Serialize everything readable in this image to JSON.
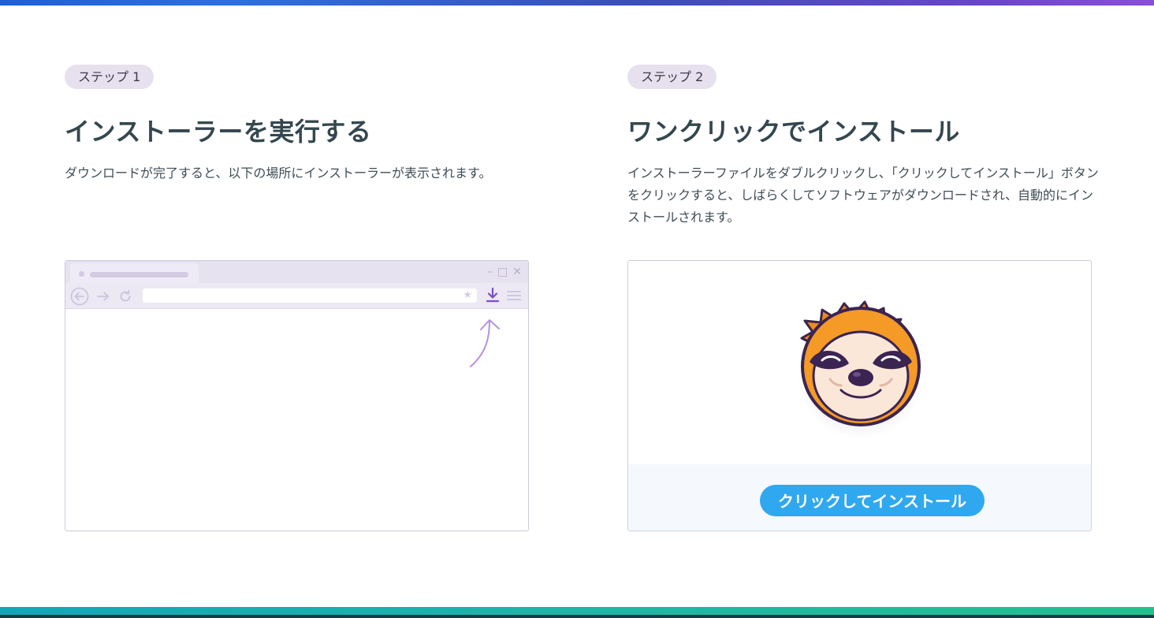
{
  "step1": {
    "pill": "ステップ 1",
    "title": "インストーラーを実行する",
    "description": "ダウンロードが完了すると、以下の場所にインストーラーが表示されます。"
  },
  "step2": {
    "pill": "ステップ 2",
    "title": "ワンクリックでインストール",
    "description": "インストーラーファイルをダブルクリックし、「クリックしてインストール」ボタンをクリックすると、しばらくしてソフトウェアがダウンロードされ、自動的にインストールされます。",
    "button_label": "クリックしてインストール"
  },
  "icons": {
    "back": "back-icon",
    "forward": "forward-icon",
    "reload": "reload-icon",
    "star": "star-icon",
    "download": "download-icon",
    "menu": "menu-icon",
    "minimize": "minimize-icon",
    "maximize": "maximize-icon",
    "close": "close-icon",
    "logo": "sloth-logo-icon"
  },
  "colors": {
    "accent_purple": "#7b4fc6",
    "install_button": "#2fa8f0",
    "pill_bg": "#e6e0ef",
    "heading": "#34474f"
  }
}
